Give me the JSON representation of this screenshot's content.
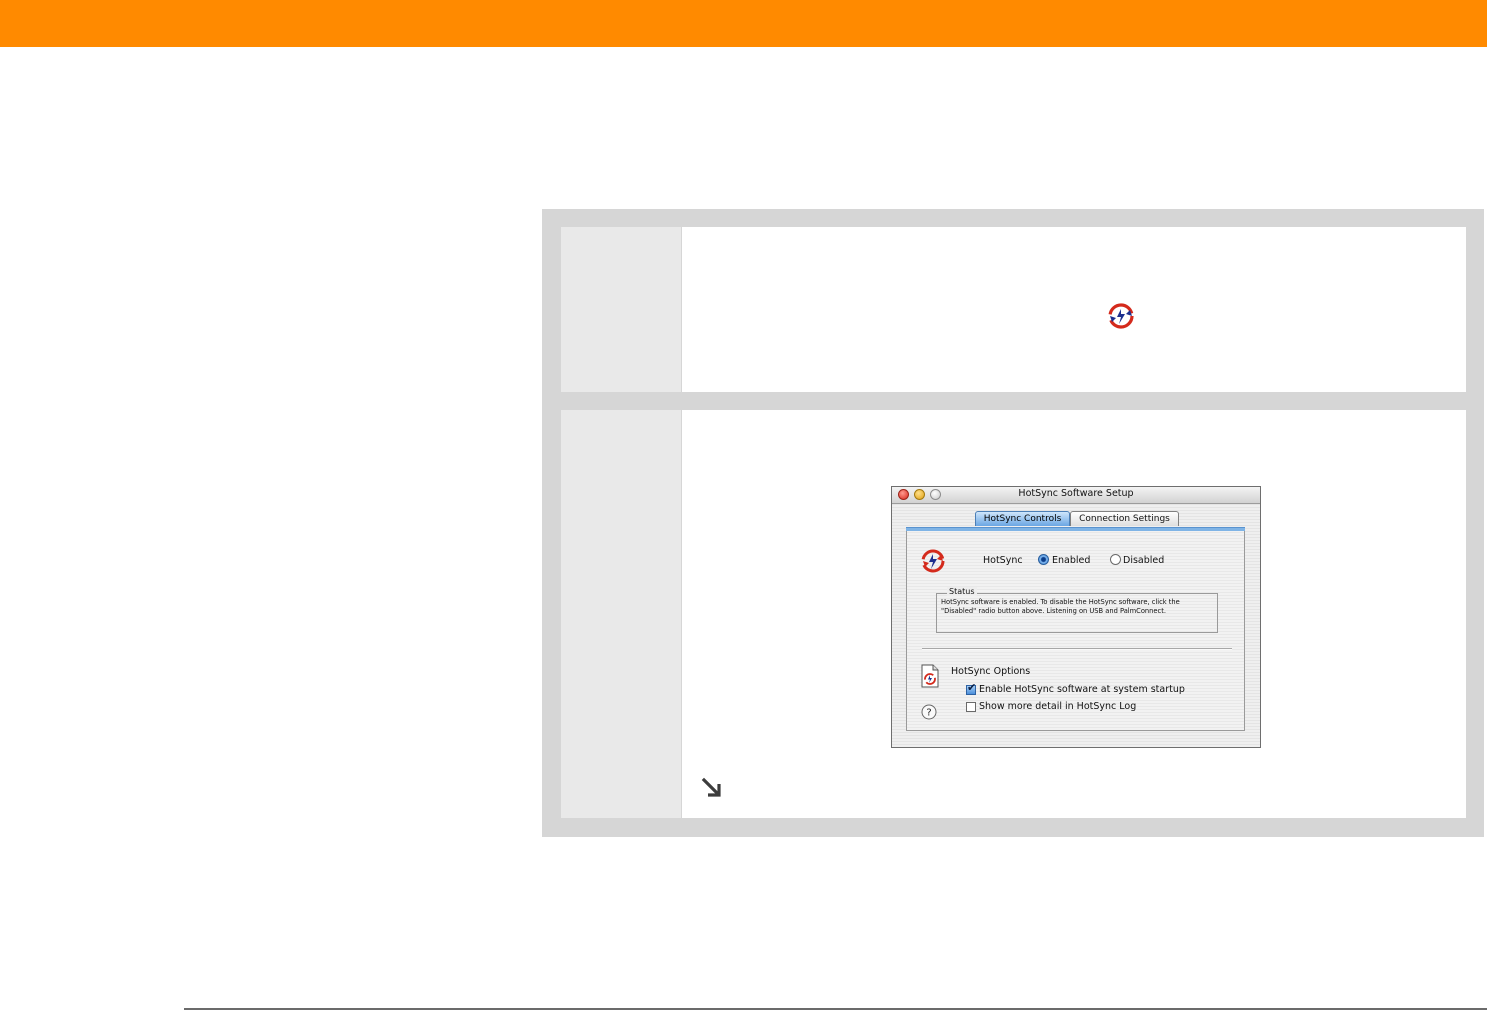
{
  "page": {
    "accent_color": "#FF8A00"
  },
  "icons": {
    "inline_step_icon": "hotsync-icon",
    "continue": "continue-arrow-icon"
  },
  "dialog": {
    "title": "HotSync Software Setup",
    "tabs": [
      {
        "label": "HotSync Controls",
        "selected": true
      },
      {
        "label": "Connection Settings",
        "selected": false
      }
    ],
    "hotsync_label": "HotSync",
    "radio_enabled": {
      "label": "Enabled",
      "checked": true
    },
    "radio_disabled": {
      "label": "Disabled",
      "checked": false
    },
    "status": {
      "legend": "Status",
      "text": "HotSync software is enabled. To disable the HotSync software, click the \"Disabled\" radio button above. Listening on USB and PalmConnect."
    },
    "options": {
      "title": "HotSync Options",
      "items": [
        {
          "label": "Enable HotSync software at system startup",
          "checked": true
        },
        {
          "label": "Show more detail in HotSync Log",
          "checked": false
        }
      ]
    }
  }
}
